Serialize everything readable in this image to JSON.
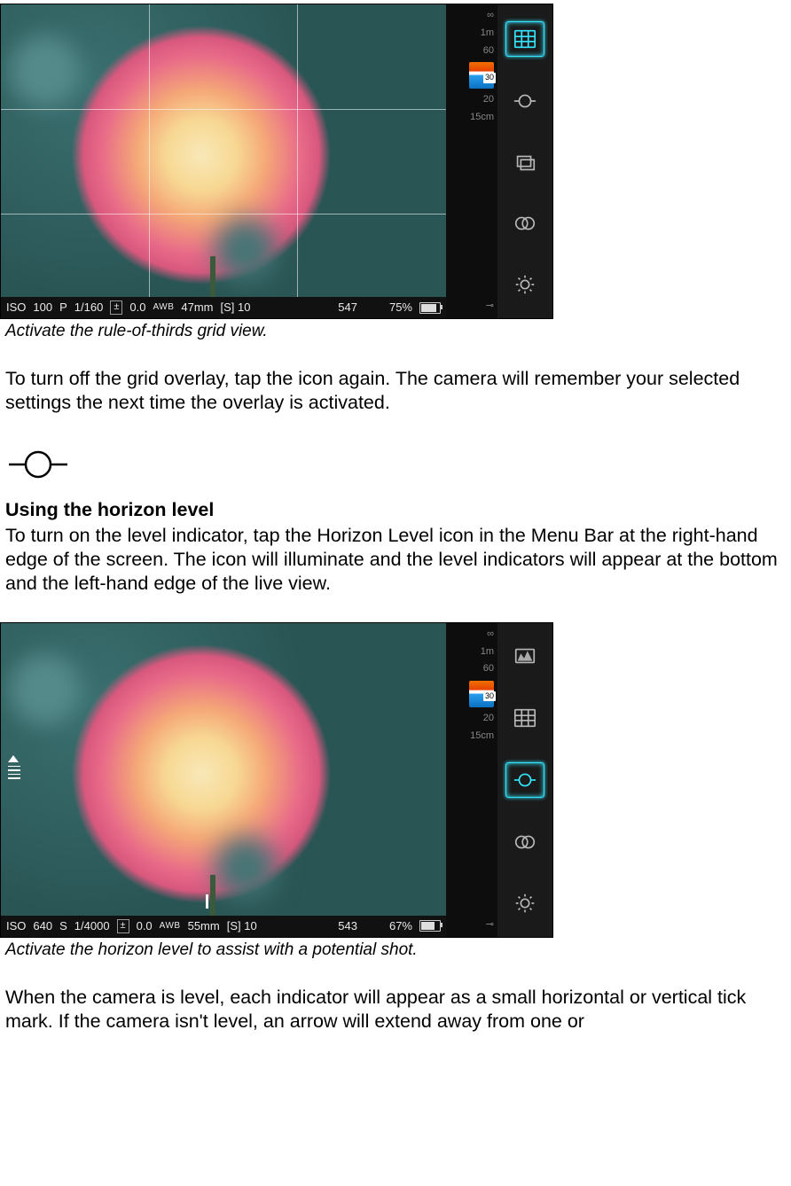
{
  "figure1": {
    "status": {
      "iso_label": "ISO",
      "iso": "100",
      "mode": "P",
      "shutter": "1/160",
      "ev_icon": "±",
      "ev": "0.0",
      "awb": "AWB",
      "focal": "47mm",
      "drive": "[S] 10",
      "shots": "547",
      "battery": "75%"
    },
    "focus_scale": {
      "inf": "∞",
      "m1": "1m",
      "m60": "60",
      "mid": "30",
      "m20": "20",
      "near": "15cm",
      "end": "⊸"
    },
    "active_icon": "grid",
    "caption": "Activate the rule-of-thirds grid view."
  },
  "para1": "To turn off the grid overlay, tap the icon again. The camera will remember your selected settings the next time the overlay is activated.",
  "section": {
    "heading": "Using the horizon level",
    "body": "To turn on the level indicator, tap the Horizon Level icon in the Menu Bar at the right-hand edge of the screen. The icon will illuminate and the level indicators will appear at the bottom and the left-hand edge of the live view."
  },
  "figure2": {
    "status": {
      "iso_label": "ISO",
      "iso": "640",
      "mode": "S",
      "shutter": "1/4000",
      "ev_icon": "±",
      "ev": "0.0",
      "awb": "AWB",
      "focal": "55mm",
      "drive": "[S] 10",
      "shots": "543",
      "battery": "67%"
    },
    "focus_scale": {
      "inf": "∞",
      "m1": "1m",
      "m60": "60",
      "mid": "30",
      "m20": "20",
      "near": "15cm",
      "end": "⊸"
    },
    "active_icon": "horizon",
    "caption": "Activate the horizon level to assist with a potential shot."
  },
  "para2": "When the camera is level, each indicator will appear as a small horizontal or vertical tick mark. If the camera isn't level, an arrow will extend away from one or"
}
